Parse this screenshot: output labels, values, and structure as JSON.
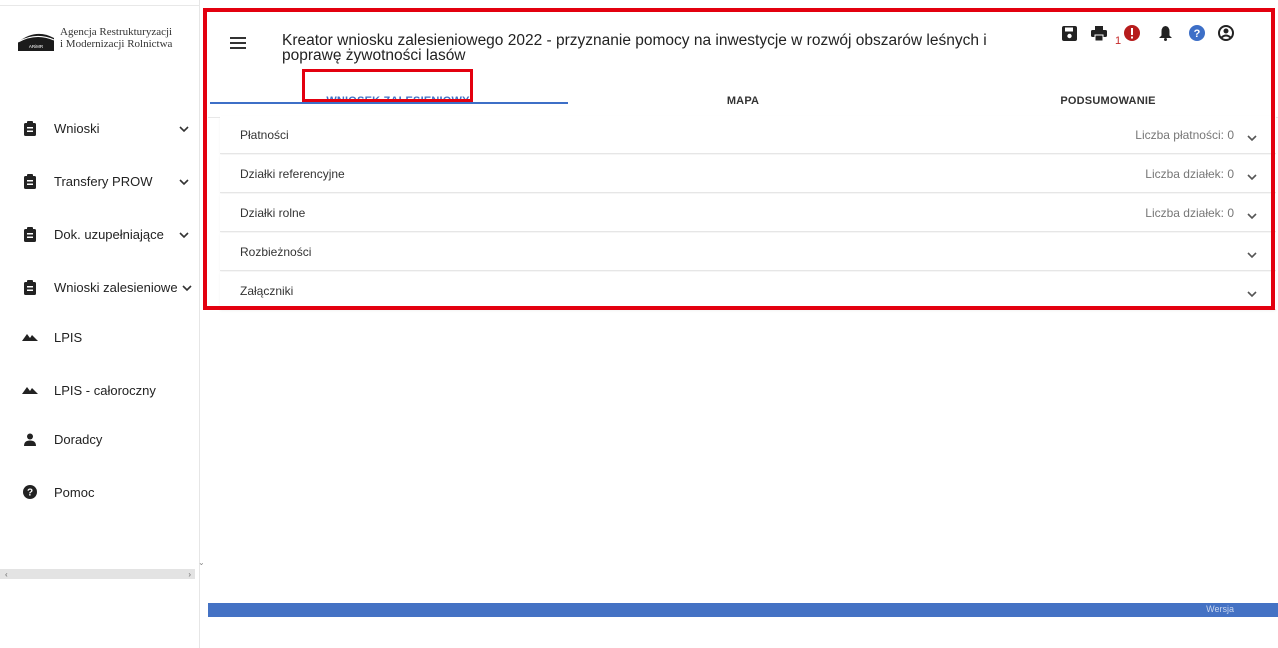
{
  "logo": {
    "line1": "Agencja Restrukturyzacji",
    "line2": "i Modernizacji Rolnictwa",
    "mark_text": "ARiMR"
  },
  "sidebar": {
    "items": [
      {
        "label": "Wnioski",
        "icon": "clipboard-icon",
        "has_chevron": true
      },
      {
        "label": "Transfery PROW",
        "icon": "clipboard-icon",
        "has_chevron": true
      },
      {
        "label": "Dok. uzupełniające",
        "icon": "clipboard-icon",
        "has_chevron": true
      },
      {
        "label": "Wnioski zalesieniowe",
        "icon": "clipboard-icon",
        "has_chevron": true
      },
      {
        "label": "LPIS",
        "icon": "terrain-icon",
        "has_chevron": false
      },
      {
        "label": "LPIS - całoroczny",
        "icon": "terrain-icon",
        "has_chevron": false
      },
      {
        "label": "Doradcy",
        "icon": "person-icon",
        "has_chevron": false
      },
      {
        "label": "Pomoc",
        "icon": "help-icon",
        "has_chevron": false
      }
    ]
  },
  "header": {
    "title": "Kreator wniosku zalesieniowego 2022 - przyznanie pomocy na inwestycje w rozwój obszarów leśnych i poprawę żywotności lasów",
    "error_count": "1",
    "icons": [
      "save-icon",
      "print-icon",
      "error-icon",
      "bell-icon",
      "help-icon",
      "account-icon"
    ]
  },
  "tabs": [
    {
      "label": "WNIOSEK ZALESIENIOWY",
      "active": true
    },
    {
      "label": "MAPA",
      "active": false
    },
    {
      "label": "PODSUMOWANIE",
      "active": false
    }
  ],
  "panels": [
    {
      "title": "Płatności",
      "meta": "Liczba płatności: 0"
    },
    {
      "title": "Działki referencyjne",
      "meta": "Liczba działek: 0"
    },
    {
      "title": "Działki rolne",
      "meta": "Liczba działek: 0"
    },
    {
      "title": "Rozbieżności",
      "meta": ""
    },
    {
      "title": "Załączniki",
      "meta": ""
    }
  ],
  "footer": {
    "text": "Wersja"
  },
  "colors": {
    "accent": "#3d6fc7",
    "highlight": "#e3000f",
    "footer": "#4472c4",
    "error": "#c62828"
  }
}
